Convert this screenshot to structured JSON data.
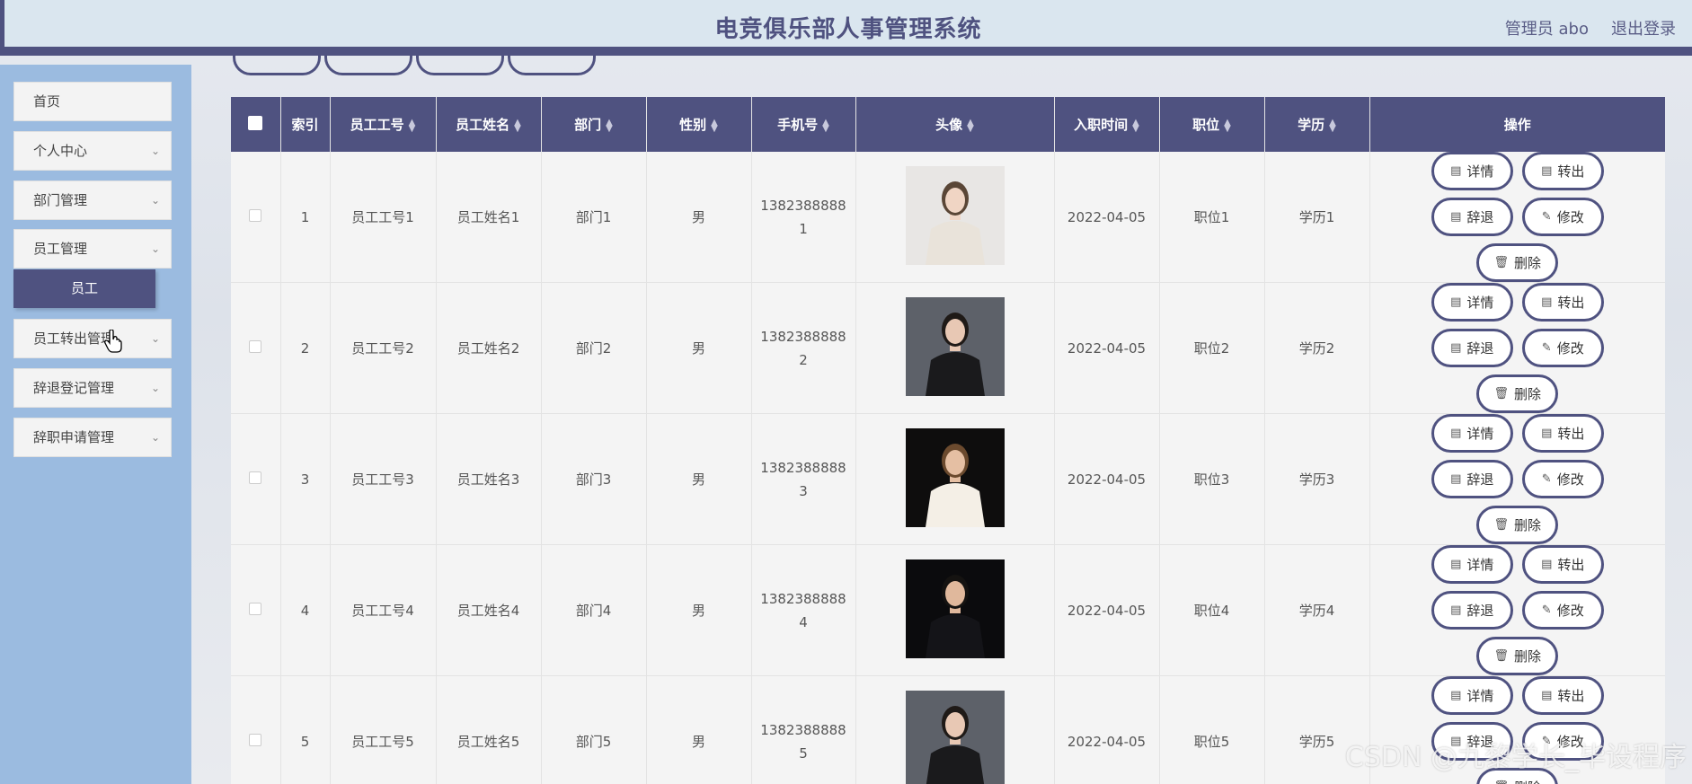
{
  "header": {
    "title": "电竞俱乐部人事管理系统",
    "user": "管理员 abo",
    "logout": "退出登录"
  },
  "sidebar": {
    "items": [
      {
        "label": "首页",
        "has_chevron": false
      },
      {
        "label": "个人中心",
        "has_chevron": true
      },
      {
        "label": "部门管理",
        "has_chevron": true
      },
      {
        "label": "员工管理",
        "has_chevron": true
      },
      {
        "label": "员工转出管理",
        "has_chevron": true
      },
      {
        "label": "辞退登记管理",
        "has_chevron": true
      },
      {
        "label": "辞职申请管理",
        "has_chevron": true
      }
    ],
    "submenu_active": "员工",
    "chevron_icon": "chevron-down-icon"
  },
  "table": {
    "headers": [
      "索引",
      "员工工号",
      "员工姓名",
      "部门",
      "性别",
      "手机号",
      "头像",
      "入职时间",
      "职位",
      "学历",
      "操作"
    ],
    "rows": [
      {
        "index": "1",
        "emp_no": "员工工号1",
        "name": "员工姓名1",
        "dept": "部门1",
        "gender": "男",
        "phone_a": "1382388888",
        "phone_b": "1",
        "date": "2022-04-05",
        "position": "职位1",
        "edu": "学历1"
      },
      {
        "index": "2",
        "emp_no": "员工工号2",
        "name": "员工姓名2",
        "dept": "部门2",
        "gender": "男",
        "phone_a": "1382388888",
        "phone_b": "2",
        "date": "2022-04-05",
        "position": "职位2",
        "edu": "学历2"
      },
      {
        "index": "3",
        "emp_no": "员工工号3",
        "name": "员工姓名3",
        "dept": "部门3",
        "gender": "男",
        "phone_a": "1382388888",
        "phone_b": "3",
        "date": "2022-04-05",
        "position": "职位3",
        "edu": "学历3"
      },
      {
        "index": "4",
        "emp_no": "员工工号4",
        "name": "员工姓名4",
        "dept": "部门4",
        "gender": "男",
        "phone_a": "1382388888",
        "phone_b": "4",
        "date": "2022-04-05",
        "position": "职位4",
        "edu": "学历4"
      },
      {
        "index": "5",
        "emp_no": "员工工号5",
        "name": "员工姓名5",
        "dept": "部门5",
        "gender": "男",
        "phone_a": "1382388888",
        "phone_b": "5",
        "date": "2022-04-05",
        "position": "职位5",
        "edu": "学历5"
      }
    ],
    "actions": {
      "detail": "详情",
      "transfer": "转出",
      "dismiss": "辞退",
      "edit": "修改",
      "delete": "删除"
    }
  },
  "watermark": "CSDN @九黎学长_毕设程序",
  "colors": {
    "primary": "#4f5280",
    "sidebar": "#9bbbe0",
    "header_bg": "#dae6ef"
  }
}
